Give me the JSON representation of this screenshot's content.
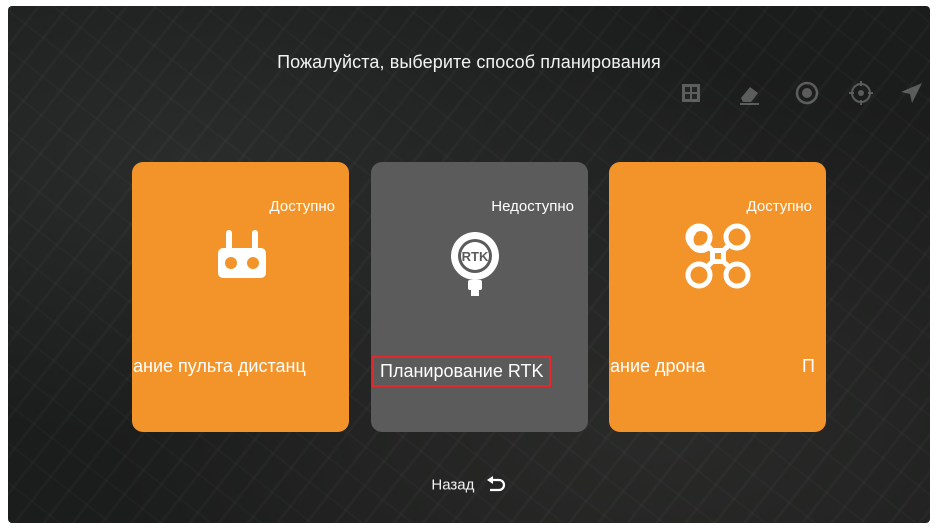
{
  "dialog": {
    "title": "Пожалуйста, выберите способ планирования",
    "back_label": "Назад",
    "back_icon": "undo-arrow-icon"
  },
  "options": [
    {
      "id": "remote",
      "status": "Доступно",
      "label": "ание пульта дистанц",
      "icon": "remote-controller-icon",
      "color": "#f2942a"
    },
    {
      "id": "rtk",
      "status": "Недоступно",
      "label": "Планирование RTK",
      "icon": "rtk-device-icon",
      "icon_text": "RTK",
      "color": "#5b5b5b",
      "highlight_color": "#e5262a"
    },
    {
      "id": "drone",
      "status": "Доступно",
      "label": "ание дрона",
      "label_extra": "П",
      "icon": "drone-icon",
      "color": "#f2942a"
    }
  ],
  "toolbar_icons": [
    "layers-icon",
    "eraser-icon",
    "compass-icon",
    "target-icon",
    "navigation-icon"
  ]
}
